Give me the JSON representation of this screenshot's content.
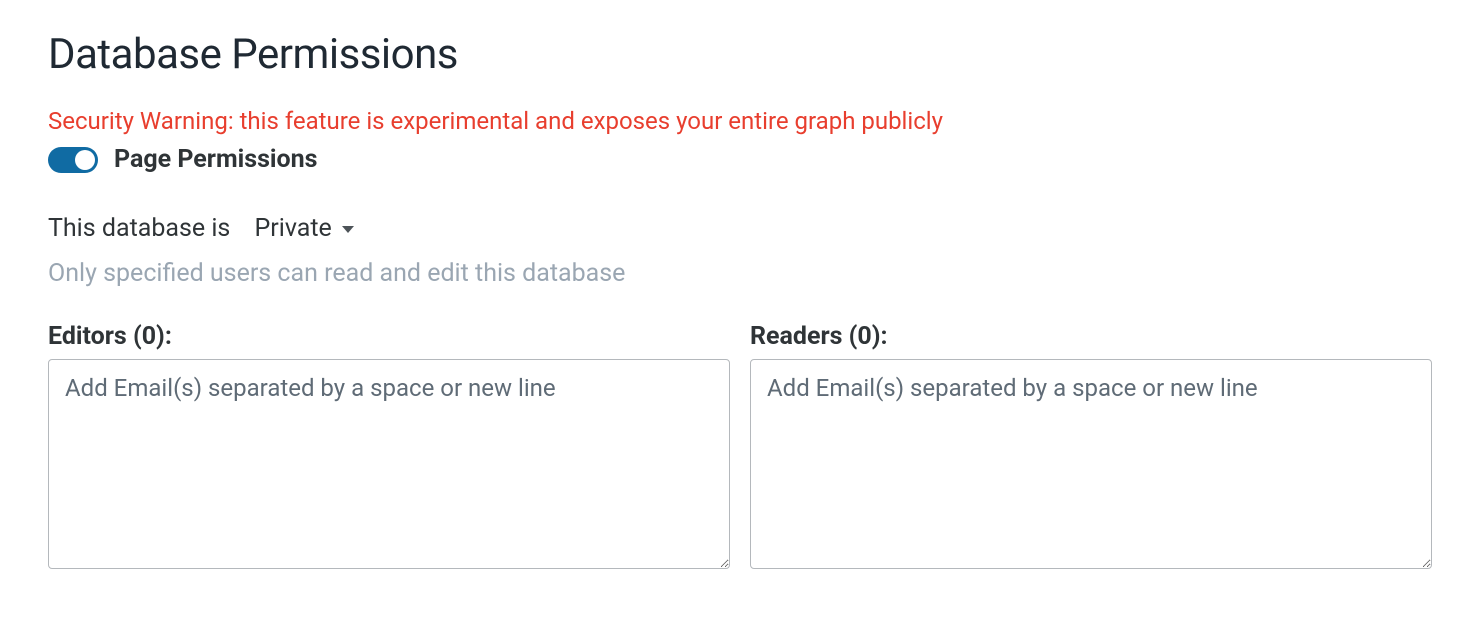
{
  "header": {
    "title": "Database Permissions",
    "warning": "Security Warning: this feature is experimental and exposes your entire graph publicly"
  },
  "toggle": {
    "label": "Page Permissions",
    "on": true
  },
  "privacy": {
    "prefix": "This database is",
    "value": "Private",
    "description": "Only specified users can read and edit this database"
  },
  "editors": {
    "label": "Editors (0):",
    "placeholder": "Add Email(s) separated by a space or new line",
    "value": ""
  },
  "readers": {
    "label": "Readers (0):",
    "placeholder": "Add Email(s) separated by a space or new line",
    "value": ""
  }
}
